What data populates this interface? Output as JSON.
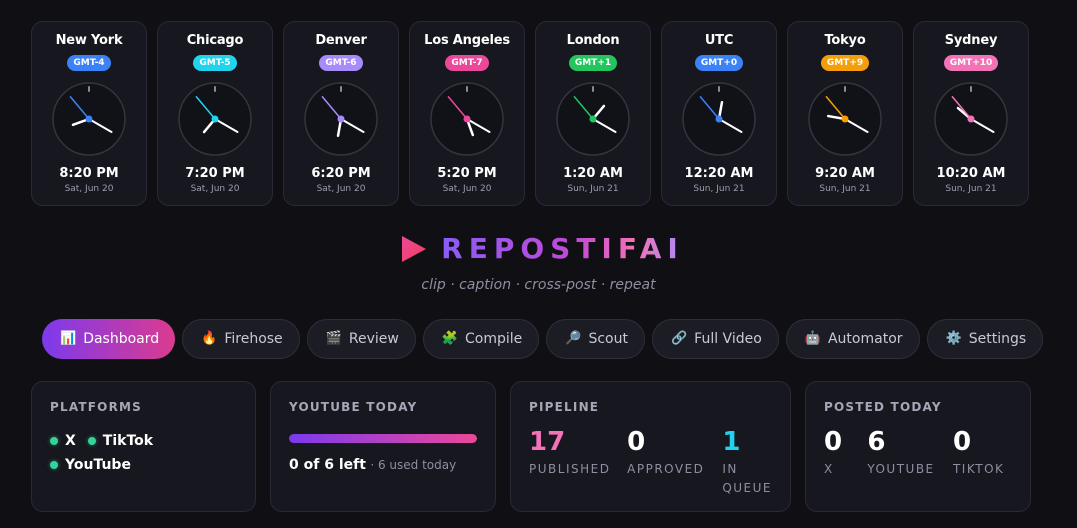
{
  "clocks": [
    {
      "city": "New York",
      "tz": "GMT-4",
      "time": "8:20 PM",
      "date": "Sat, Jun 20",
      "color": "#3b82f6",
      "h": 20,
      "m": 20
    },
    {
      "city": "Chicago",
      "tz": "GMT-5",
      "time": "7:20 PM",
      "date": "Sat, Jun 20",
      "color": "#22d3ee",
      "h": 19,
      "m": 20
    },
    {
      "city": "Denver",
      "tz": "GMT-6",
      "time": "6:20 PM",
      "date": "Sat, Jun 20",
      "color": "#a78bfa",
      "h": 18,
      "m": 20
    },
    {
      "city": "Los Angeles",
      "tz": "GMT-7",
      "time": "5:20 PM",
      "date": "Sat, Jun 20",
      "color": "#ec4899",
      "h": 17,
      "m": 20
    },
    {
      "city": "London",
      "tz": "GMT+1",
      "time": "1:20 AM",
      "date": "Sun, Jun 21",
      "color": "#22c55e",
      "h": 1,
      "m": 20
    },
    {
      "city": "UTC",
      "tz": "GMT+0",
      "time": "12:20 AM",
      "date": "Sun, Jun 21",
      "color": "#3b82f6",
      "h": 0,
      "m": 20
    },
    {
      "city": "Tokyo",
      "tz": "GMT+9",
      "time": "9:20 AM",
      "date": "Sun, Jun 21",
      "color": "#f59e0b",
      "h": 9,
      "m": 20
    },
    {
      "city": "Sydney",
      "tz": "GMT+10",
      "time": "10:20 AM",
      "date": "Sun, Jun 21",
      "color": "#f472b6",
      "h": 10,
      "m": 20
    }
  ],
  "brand": {
    "name": "REPOSTIFAI",
    "tagline": "clip · caption · cross-post · repeat",
    "icon": "play-triangle-icon"
  },
  "nav": [
    {
      "label": "Dashboard",
      "icon": "📊",
      "active": true
    },
    {
      "label": "Firehose",
      "icon": "🔥",
      "active": false
    },
    {
      "label": "Review",
      "icon": "🎬",
      "active": false
    },
    {
      "label": "Compile",
      "icon": "🧩",
      "active": false
    },
    {
      "label": "Scout",
      "icon": "🔎",
      "active": false
    },
    {
      "label": "Full Video",
      "icon": "🔗",
      "active": false
    },
    {
      "label": "Automator",
      "icon": "🤖",
      "active": false
    },
    {
      "label": "Settings",
      "icon": "⚙️",
      "active": false
    }
  ],
  "platforms": {
    "title": "PLATFORMS",
    "items": [
      "X",
      "TikTok",
      "YouTube"
    ],
    "status_color": "#34d399"
  },
  "youtube_today": {
    "title": "YOUTUBE TODAY",
    "left_text": "0 of 6 left",
    "used_text": "· 6 used today",
    "used": 6,
    "limit": 6
  },
  "pipeline": {
    "title": "PIPELINE",
    "stats": [
      {
        "value": "17",
        "label": "PUBLISHED",
        "color": "#f472b6"
      },
      {
        "value": "0",
        "label": "APPROVED",
        "color": "#ffffff"
      },
      {
        "value": "1",
        "label": "IN QUEUE",
        "color": "#22d3ee"
      }
    ]
  },
  "posted_today": {
    "title": "POSTED TODAY",
    "stats": [
      {
        "value": "0",
        "label": "X"
      },
      {
        "value": "6",
        "label": "YOUTUBE"
      },
      {
        "value": "0",
        "label": "TIKTOK"
      }
    ]
  }
}
